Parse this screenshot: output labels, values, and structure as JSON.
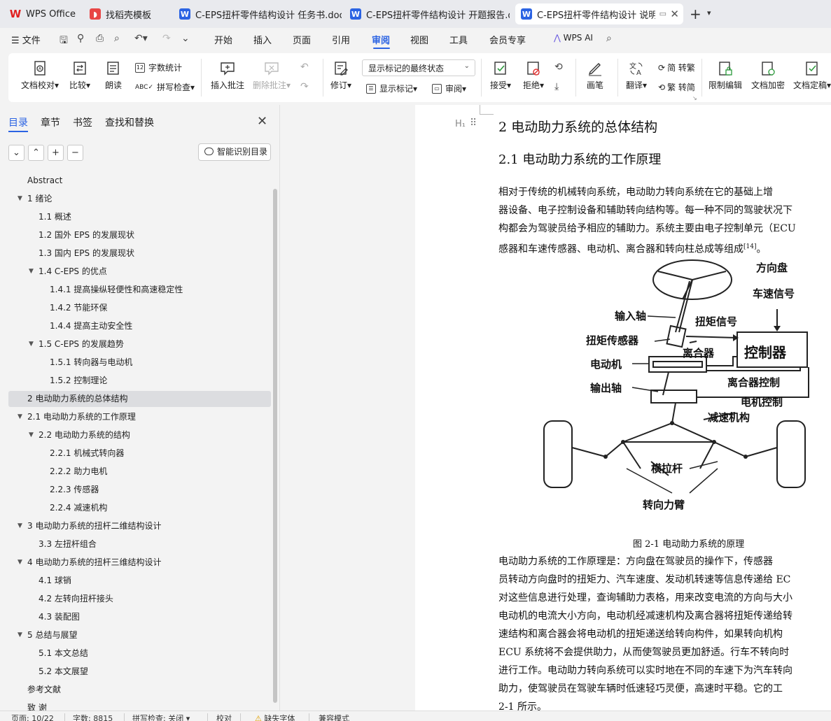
{
  "tabs": [
    {
      "label": "WPS Office",
      "icon": "wps-logo-icon"
    },
    {
      "label": "找稻壳模板",
      "icon": "docer-icon"
    },
    {
      "label": "C-EPS扭杆零件结构设计 任务书.doc",
      "icon": "word-doc-icon"
    },
    {
      "label": "C-EPS扭杆零件结构设计 开题报告.doc",
      "icon": "word-doc-icon"
    },
    {
      "label": "C-EPS扭杆零件结构设计 说明书",
      "icon": "word-doc-icon",
      "active": true
    }
  ],
  "menu": {
    "file": "文件",
    "items": [
      "开始",
      "插入",
      "页面",
      "引用",
      "审阅",
      "视图",
      "工具",
      "会员专享"
    ],
    "active": "审阅",
    "wps_ai": "WPS AI"
  },
  "ribbon": {
    "doc_check": "文档校对",
    "compare": "比较",
    "read_aloud": "朗读",
    "word_count": "字数统计",
    "spell_check": "拼写检查",
    "insert_comment": "插入批注",
    "delete_comment": "删除批注",
    "revise": "修订",
    "markup_mode": "显示标记的最终状态",
    "show_markup": "显示标记",
    "review": "审阅",
    "accept": "接受",
    "reject": "拒绝",
    "ink": "画笔",
    "translate": "翻译",
    "to_traditional": "简 转繁",
    "to_simplified": "繁 转简",
    "restrict_edit": "限制编辑",
    "encrypt": "文档加密",
    "finalize": "文档定稿"
  },
  "nav": {
    "tabs": [
      "目录",
      "章节",
      "书签",
      "查找和替换"
    ],
    "active_tab": "目录",
    "smart_toc": "智能识别目录",
    "toc": [
      {
        "label": "Abstract",
        "level": 0,
        "expander": false
      },
      {
        "label": "1  绪论",
        "level": 0,
        "expander": true
      },
      {
        "label": "1.1  概述",
        "level": 1,
        "expander": false
      },
      {
        "label": "1.2  国外 EPS 的发展现状",
        "level": 1,
        "expander": false
      },
      {
        "label": "1.3  国内 EPS 的发展现状",
        "level": 1,
        "expander": false
      },
      {
        "label": "1.4    C-EPS 的优点",
        "level": 1,
        "expander": true
      },
      {
        "label": "1.4.1  提高操纵轻便性和高速稳定性",
        "level": 2,
        "expander": false
      },
      {
        "label": "1.4.2  节能环保",
        "level": 2,
        "expander": false
      },
      {
        "label": "1.4.4  提高主动安全性",
        "level": 2,
        "expander": false
      },
      {
        "label": "1.5    C-EPS 的发展趋势",
        "level": 1,
        "expander": true
      },
      {
        "label": "1.5.1  转向器与电动机",
        "level": 2,
        "expander": false
      },
      {
        "label": "1.5.2  控制理论",
        "level": 2,
        "expander": false
      },
      {
        "label": "2  电动助力系统的总体结构",
        "level": 0,
        "expander": false,
        "selected": true
      },
      {
        "label": "2.1  电动助力系统的工作原理",
        "level": 0,
        "expander": true
      },
      {
        "label": "2.2  电动助力系统的结构",
        "level": 1,
        "expander": true
      },
      {
        "label": "2.2.1  机械式转向器",
        "level": 2,
        "expander": false
      },
      {
        "label": "2.2.2  助力电机",
        "level": 2,
        "expander": false
      },
      {
        "label": "2.2.3  传感器",
        "level": 2,
        "expander": false
      },
      {
        "label": "2.2.4  减速机构",
        "level": 2,
        "expander": false
      },
      {
        "label": "3  电动助力系统的扭杆二维结构设计",
        "level": 0,
        "expander": true
      },
      {
        "label": "3.3  左扭杆组合",
        "level": 1,
        "expander": false
      },
      {
        "label": "4  电动助力系统的扭杆三维结构设计",
        "level": 0,
        "expander": true
      },
      {
        "label": "4.1  球销",
        "level": 1,
        "expander": false
      },
      {
        "label": "4.2  左转向扭杆接头",
        "level": 1,
        "expander": false
      },
      {
        "label": "4.3  装配图",
        "level": 1,
        "expander": false
      },
      {
        "label": "5  总结与展望",
        "level": 0,
        "expander": true
      },
      {
        "label": "5.1  本文总结",
        "level": 1,
        "expander": false
      },
      {
        "label": "5.2  本文展望",
        "level": 1,
        "expander": false
      },
      {
        "label": "参考文献",
        "level": 0,
        "expander": false
      },
      {
        "label": "致    谢",
        "level": 0,
        "expander": false
      }
    ]
  },
  "document": {
    "heading1": "2  电动助力系统的总体结构",
    "heading2": "2.1  电动助力系统的工作原理",
    "para1": [
      "    相对于传统的机械转向系统，电动助力转向系统在它的基础上增",
      "器设备、电子控制设备和辅助转向结构等。每一种不同的驾驶状况下",
      "构都会为驾驶员给予相应的辅助力。系统主要由电子控制单元（ECU",
      "感器和车速传感器、电动机、离合器和转向柱总成等组成"
    ],
    "para1_ref": "[14]",
    "para1_end": "。",
    "figure_labels": {
      "steering_wheel": "方向盘",
      "speed_signal": "车速信号",
      "input_shaft": "输入轴",
      "torque_signal": "扭矩信号",
      "torque_sensor": "扭矩传感器",
      "clutch": "离合器",
      "controller": "控制器",
      "motor": "电动机",
      "output_shaft": "输出轴",
      "clutch_control": "离合器控制",
      "motor_control": "电机控制",
      "reducer": "减速机构",
      "tie_rod": "横拉杆",
      "steering_arm": "转向力臂"
    },
    "caption": "图 2-1  电动助力系统的原理",
    "para2": [
      "    电动助力系统的工作原理是：方向盘在驾驶员的操作下，传感器",
      "员转动方向盘时的扭矩力、汽车速度、发动机转速等信息传递给 EC",
      "对这些信息进行处理，查询辅助力表格，用来改变电流的方向与大小",
      "电动机的电流大小方向，电动机经减速机构及离合器将扭矩传递给转",
      "速结构和离合器会将电动机的扭矩递送给转向构件，如果转向机构",
      "ECU 系统将不会提供助力，从而使驾驶员更加舒适。行车不转向时",
      "进行工作。电动助力转向系统可以实时地在不同的车速下为汽车转向",
      "助力，使驾驶员在驾驶车辆时低速轻巧灵便，高速时平稳。它的工",
      "2-1 所示。"
    ]
  },
  "status": {
    "page": "页面: 10/22",
    "words": "字数: 8815",
    "spell": "拼写检查: 关闭",
    "proof": "校对",
    "missing_font": "缺失字体",
    "compat": "兼容模式"
  },
  "colors": {
    "accent": "#2b63e3",
    "wps_red": "#e02020"
  }
}
